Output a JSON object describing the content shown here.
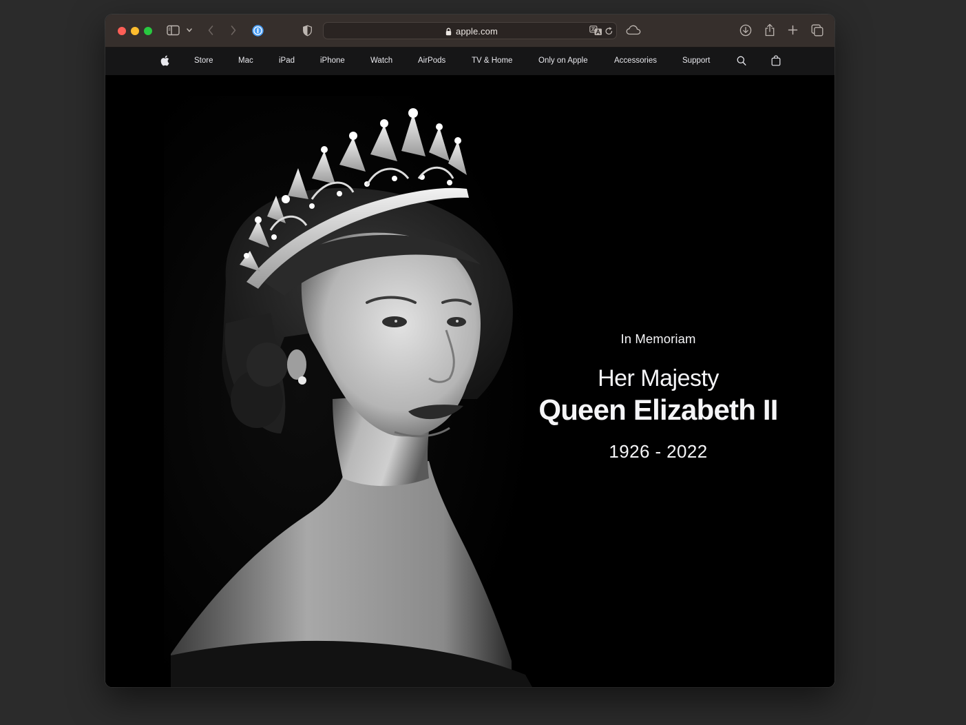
{
  "browser": {
    "address_url": "apple.com"
  },
  "globalnav": {
    "items": [
      "Store",
      "Mac",
      "iPad",
      "iPhone",
      "Watch",
      "AirPods",
      "TV & Home",
      "Only on Apple",
      "Accessories",
      "Support"
    ]
  },
  "hero": {
    "eyebrow": "In Memoriam",
    "headline_line1": "Her Majesty",
    "headline_line2": "Queen Elizabeth II",
    "dates": "1926 - 2022"
  },
  "colors": {
    "toolbar": "#362f2c",
    "nav_background": "#161617",
    "hero_background": "#000000",
    "hero_text": "#f5f5f7",
    "traffic_red": "#fe5f57",
    "traffic_yellow": "#febc2e",
    "traffic_green": "#28c840",
    "password_manager_blue": "#4a9ef5"
  }
}
